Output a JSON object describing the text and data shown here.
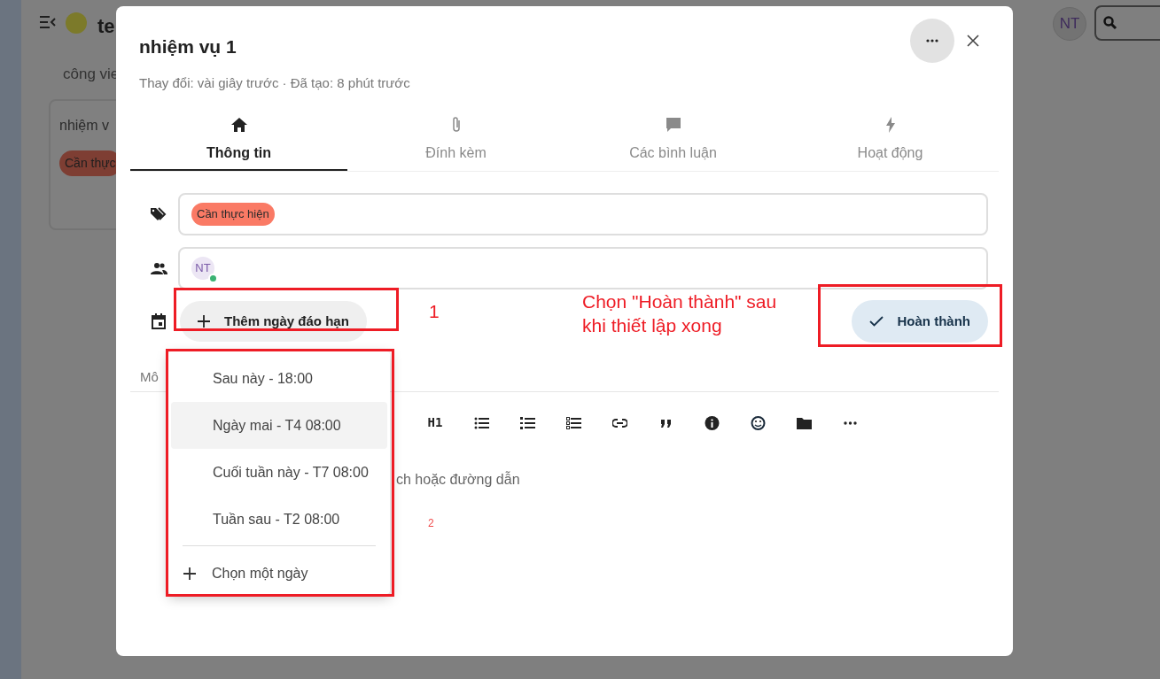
{
  "background": {
    "board_title": "te",
    "list_title": "công vie",
    "card": {
      "title": "nhiệm v",
      "tag": "Cần thực"
    },
    "avatar": "NT"
  },
  "dialog": {
    "title": "nhiệm vụ 1",
    "meta": "Thay đổi: vài giây trước · Đã tạo: 8 phút trước",
    "tabs": [
      {
        "label": "Thông tin",
        "selected": true
      },
      {
        "label": "Đính kèm",
        "selected": false
      },
      {
        "label": "Các bình luận",
        "selected": false
      },
      {
        "label": "Hoạt động",
        "selected": false
      }
    ],
    "tags": [
      "Cần thực hiện"
    ],
    "assignees": [
      {
        "initials": "NT",
        "online": true
      }
    ],
    "due_button": "Thêm ngày đáo hạn",
    "done_button": "Hoàn thành",
    "description": {
      "label": "Mô",
      "placeholder": "ch hoặc đường dẫn",
      "heading_button": "H1",
      "note": "2"
    }
  },
  "due_menu": {
    "items": [
      {
        "label": "Sau này - 18:00",
        "selected": false
      },
      {
        "label": "Ngày mai - T4 08:00",
        "selected": true
      },
      {
        "label": "Cuối tuần này - T7 08:00",
        "selected": false
      },
      {
        "label": "Tuần sau - T2 08:00",
        "selected": false
      }
    ],
    "custom": "Chọn một ngày"
  },
  "annotations": [
    {
      "kind": "number",
      "text": "1"
    },
    {
      "kind": "note",
      "text": "Chọn \"Hoàn thành\" sau khi thiết lập xong"
    }
  ]
}
